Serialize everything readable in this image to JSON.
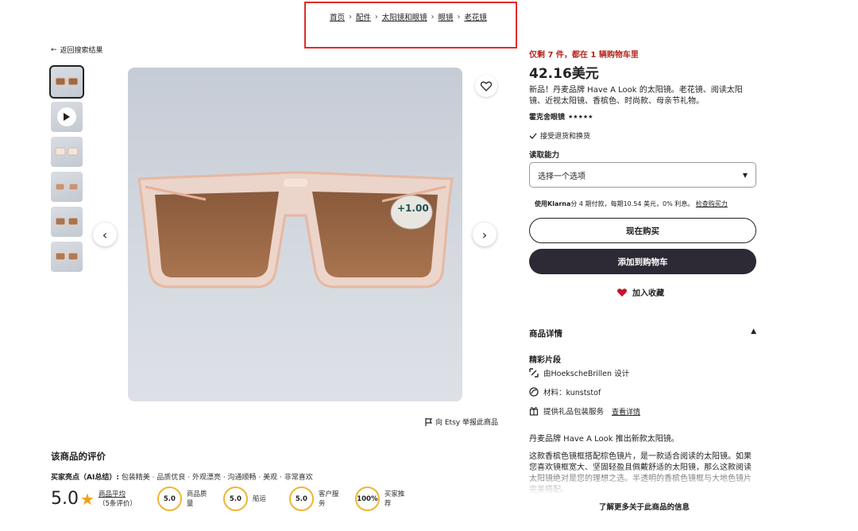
{
  "breadcrumb": {
    "items": [
      "首页",
      "配件",
      "太阳镜和眼镜",
      "眼镜",
      "老花镜"
    ]
  },
  "back_link": "返回搜索结果",
  "product_image": {
    "badge_text": "+1.00"
  },
  "report_link": "向 Etsy 举报此商品",
  "reviews": {
    "title": "该商品的评价",
    "highlights_label": "买家亮点（AI总结）:",
    "highlights_text": "包装精美 · 品质优良 · 外观漂亮 · 沟通顺畅 · 美观 · 非常喜欢",
    "score": "5.0",
    "avg_label": "商品平均",
    "count": "（5条评价）",
    "metrics": [
      {
        "value": "5.0",
        "label": "商品质量"
      },
      {
        "value": "5.0",
        "label": "船运"
      },
      {
        "value": "5.0",
        "label": "客户服务"
      },
      {
        "value": "100%",
        "label": "买家推荐"
      }
    ]
  },
  "product": {
    "stock_notice": "仅剩 7 件，都在 1 辆购物车里",
    "price": "42.16美元",
    "description": "新品！丹麦品牌 Have A Look 的太阳镜。老花镜、阅读太阳镜、近视太阳镜、香槟色、时尚款、母亲节礼物。",
    "shop_name": "霍克舍眼镜",
    "shop_stars": "★★★★★",
    "returns": "接受退货和换货",
    "option_label": "读取能力",
    "option_placeholder": "选择一个选项",
    "klarna_brand": "使用Klarna",
    "klarna_text": "分 4 期付款，每期10.54 美元，0% 利息。",
    "klarna_link": "检查购买力",
    "buy_now": "现在购买",
    "add_to_cart": "添加到购物车",
    "add_favorite": "加入收藏"
  },
  "details": {
    "title": "商品详情",
    "highlights_title": "精彩片段",
    "designer": "由HoekscheBrillen 设计",
    "material": "材料：kunststof",
    "gift": "提供礼品包装服务",
    "gift_link": "查看详情",
    "intro": "丹麦品牌 Have A Look 推出新款太阳镜。",
    "long_description": "这款香槟色镜框搭配棕色镜片，是一款适合阅读的太阳镜。如果您喜欢镜框宽大、坚固轻盈且佩戴舒适的太阳镜，那么这款阅读太阳镜绝对是您的理想之选。半透明的香槟色镜框与大地色镜片完美搭配。",
    "learn_more": "了解更多关于此商品的信息"
  },
  "colors": {
    "highlight_box": "#e02b2b",
    "stock_red": "#b3261e",
    "dark_button": "#2d2a35",
    "star": "#f1a10a"
  }
}
